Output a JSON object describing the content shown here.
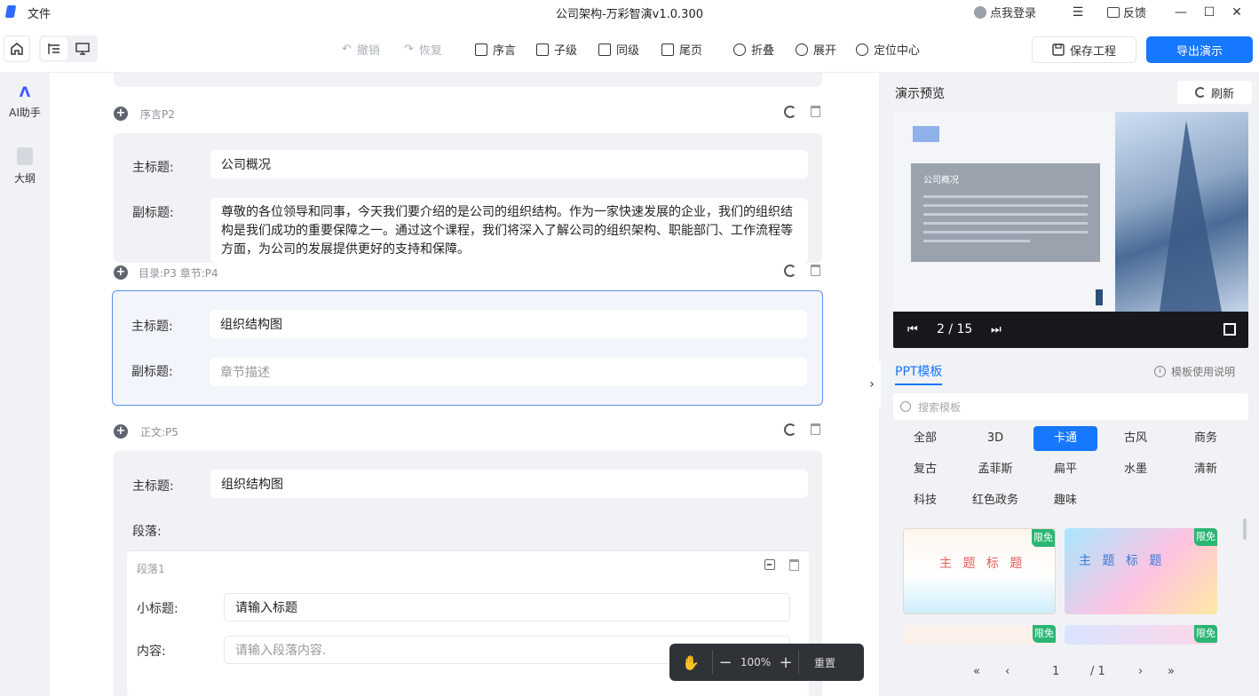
{
  "titlebar": {
    "file_menu": "文件",
    "title": "公司架构-万彩智演v1.0.300",
    "login": "点我登录",
    "feedback": "反馈"
  },
  "toolbar": {
    "undo": "撤销",
    "redo": "恢复",
    "preface": "序言",
    "child": "子级",
    "sibling": "同级",
    "ending": "尾页",
    "collapse": "折叠",
    "expand": "展开",
    "locate_center": "定位中心",
    "save_project": "保存工程",
    "export_presentation": "导出演示"
  },
  "rail": {
    "ai_assistant": "AI助手",
    "outline": "大纲"
  },
  "editor": {
    "sections": [
      {
        "label": "序言P2",
        "main_title_label": "主标题:",
        "main_title": "公司概况",
        "subtitle_label": "副标题:",
        "subtitle": "尊敬的各位领导和同事，今天我们要介绍的是公司的组织结构。作为一家快速发展的企业，我们的组织结构是我们成功的重要保障之一。通过这个课程，我们将深入了解公司的组织架构、职能部门、工作流程等方面，为公司的发展提供更好的支持和保障。"
      },
      {
        "label": "目录:P3   章节:P4",
        "main_title_label": "主标题:",
        "main_title": "组织结构图",
        "subtitle_label": "副标题:",
        "subtitle_placeholder": "章节描述"
      },
      {
        "label": "正文:P5",
        "main_title_label": "主标题:",
        "main_title": "组织结构图",
        "paragraph_label": "段落:",
        "paragraph": {
          "title": "段落1",
          "subtitle_label": "小标题:",
          "subtitle_placeholder": "请输入标题",
          "content_label": "内容:",
          "content_placeholder": "请输入段落内容."
        }
      }
    ],
    "zoom": {
      "value": "100%",
      "reset": "重置"
    }
  },
  "preview": {
    "title": "演示预览",
    "refresh": "刷新",
    "slide_title": "公司概况",
    "page": "2 / 15"
  },
  "templates": {
    "tab": "PPT模板",
    "help": "模板使用说明",
    "search_placeholder": "搜索模板",
    "categories": [
      "全部",
      "3D",
      "卡通",
      "古风",
      "商务",
      "复古",
      "孟菲斯",
      "扁平",
      "水墨",
      "清新",
      "科技",
      "红色政务",
      "趣味"
    ],
    "selected_category": "卡通",
    "thumbs": [
      {
        "title": "主 题 标 题",
        "badge": "限免"
      },
      {
        "title": "主 题 标 题",
        "badge": "限免"
      },
      {
        "badge": "限免"
      },
      {
        "badge": "限免"
      }
    ],
    "pager": {
      "current": "1",
      "total": "/ 1"
    }
  },
  "colors": {
    "accent": "#1677ff",
    "active_border": "#5b8ef0",
    "badge": "#2bb673"
  }
}
